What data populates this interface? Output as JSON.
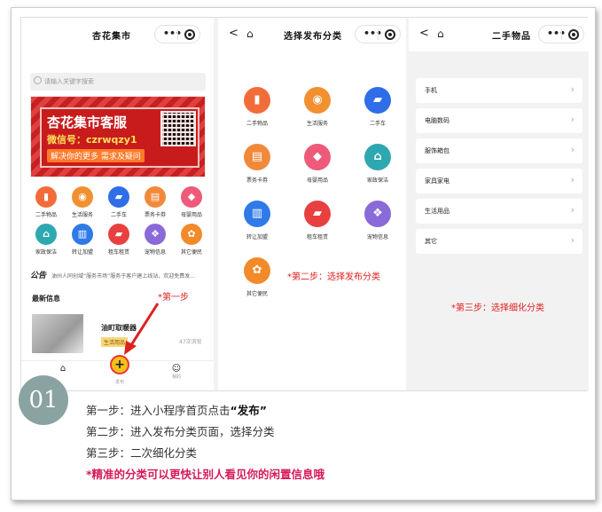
{
  "colors": {
    "accent_red": "#e02020",
    "tip_magenta": "#d61a5a",
    "badge_gray": "#8aa2a2"
  },
  "screen1": {
    "title": "杏花集市",
    "search_placeholder": "请输入关键字搜索",
    "banner": {
      "title": "杏花集市客服",
      "wechat": "微信号：czrwqzy1",
      "slogan": "解决你的更多 需求及疑问"
    },
    "categories": [
      {
        "label": "二手物品",
        "icon": "phone-icon",
        "color": "#f26c3a"
      },
      {
        "label": "生活服务",
        "icon": "location-icon",
        "color": "#f29030"
      },
      {
        "label": "二手车",
        "icon": "car-icon",
        "color": "#2f6ee8"
      },
      {
        "label": "票务卡券",
        "icon": "ticket-icon",
        "color": "#f08a3a"
      },
      {
        "label": "母婴用品",
        "icon": "tag-icon",
        "color": "#ee5a7a"
      },
      {
        "label": "家政保洁",
        "icon": "house-icon",
        "color": "#2ea8b0"
      },
      {
        "label": "转让加盟",
        "icon": "shop-icon",
        "color": "#2f7ae8"
      },
      {
        "label": "租车租赁",
        "icon": "car-rent-icon",
        "color": "#e84040"
      },
      {
        "label": "宠物信息",
        "icon": "pet-icon",
        "color": "#8a6ad8"
      },
      {
        "label": "其它便民",
        "icon": "clover-icon",
        "color": "#f28a2a"
      }
    ],
    "notice_label": "公告",
    "notice_text": "油州人同创域“服务市场”服务于客户建上线站，欢迎免费发…",
    "section_title": "最新信息",
    "card": {
      "title": "油町取暖器",
      "tag": "生活用品",
      "views": "47次浏览"
    },
    "tabs": {
      "home": "",
      "publish": "发布",
      "mine": "我的"
    },
    "step_note": "*第一步"
  },
  "screen2": {
    "title": "选择发布分类",
    "categories": [
      {
        "label": "二手物品",
        "icon": "phone-icon",
        "color": "#f26c3a"
      },
      {
        "label": "生活服务",
        "icon": "location-icon",
        "color": "#f29030"
      },
      {
        "label": "二手车",
        "icon": "car-icon",
        "color": "#2f6ee8"
      },
      {
        "label": "票务卡券",
        "icon": "ticket-icon",
        "color": "#f08a3a"
      },
      {
        "label": "母婴用品",
        "icon": "tag-icon",
        "color": "#ee5a7a"
      },
      {
        "label": "家政保洁",
        "icon": "house-icon",
        "color": "#2ea8b0"
      },
      {
        "label": "转让加盟",
        "icon": "shop-icon",
        "color": "#2f7ae8"
      },
      {
        "label": "租车租赁",
        "icon": "car-rent-icon",
        "color": "#e84040"
      },
      {
        "label": "宠物信息",
        "icon": "pet-icon",
        "color": "#8a6ad8"
      },
      {
        "label": "其它便民",
        "icon": "clover-icon",
        "color": "#f28a2a"
      }
    ],
    "step_note": "*第二步：选择发布分类"
  },
  "screen3": {
    "title": "二手物品",
    "items": [
      "手机",
      "电脑数码",
      "服饰箱包",
      "家具家电",
      "生活用品",
      "其它"
    ],
    "step_note": "*第三步：选择细化分类"
  },
  "instructions": {
    "badge": "01",
    "line1_prefix": "第一步：进入小程序首页点击",
    "line1_quote": "“发布”",
    "line2": "第二步：进入发布分类页面，选择分类",
    "line3": "第三步：二次细化分类",
    "tip": "*精准的分类可以更快让别人看见你的闲置信息哦"
  }
}
